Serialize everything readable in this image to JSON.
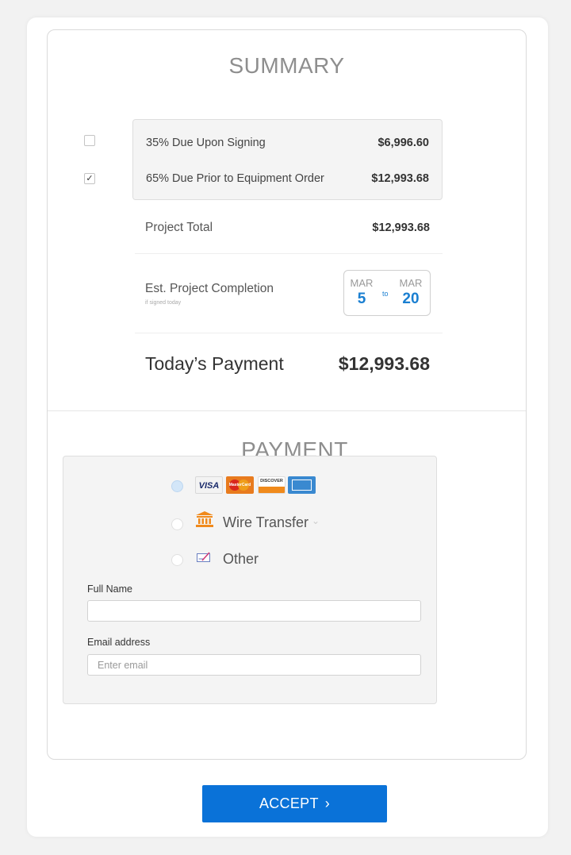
{
  "summary": {
    "title": "SUMMARY",
    "items": [
      {
        "label": "35% Due Upon Signing",
        "amount": "$6,996.60",
        "checked": false
      },
      {
        "label": "65% Due Prior to Equipment Order",
        "amount": "$12,993.68",
        "checked": true
      }
    ],
    "project_total_label": "Project Total",
    "project_total_amount": "$12,993.68",
    "completion_label": "Est. Project Completion",
    "completion_sub": "if signed today",
    "date_from_month": "MAR",
    "date_from_day": "5",
    "date_to_word": "to",
    "date_to_month": "MAR",
    "date_to_day": "20",
    "today_label": "Today’s Payment",
    "today_amount": "$12,993.68"
  },
  "payment": {
    "title": "PAYMENT",
    "cards": [
      "VISA",
      "MasterCard",
      "DISCOVER",
      "AMERICAN EXPRESS"
    ],
    "wire_label": "Wire Transfer",
    "other_label": "Other",
    "selected_method": "cards",
    "full_name_label": "Full Name",
    "full_name_value": "",
    "email_label": "Email address",
    "email_placeholder": "Enter email",
    "email_value": ""
  },
  "accept_label": "ACCEPT",
  "colors": {
    "accent": "#0a72d8",
    "date_blue": "#1a7fd1",
    "bank_orange": "#f08a1c"
  }
}
